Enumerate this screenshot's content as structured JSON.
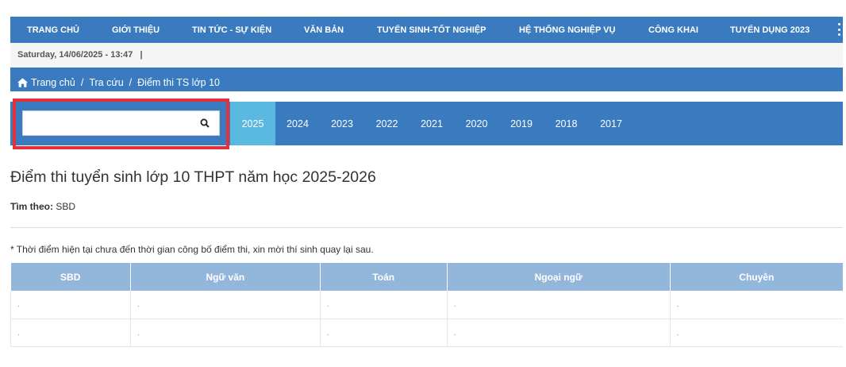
{
  "nav": {
    "items": [
      "TRANG CHỦ",
      "GIỚI THIỆU",
      "TIN TỨC - SỰ KIỆN",
      "VĂN BẢN",
      "TUYỂN SINH-TỐT NGHIỆP",
      "HỆ THỐNG NGHIỆP VỤ",
      "CÔNG KHAI",
      "TUYỂN DỤNG 2023"
    ],
    "more_icon": "vertical-ellipsis-icon"
  },
  "datebar": {
    "datetime": "Saturday, 14/06/2025 - 13:47",
    "separator": "|"
  },
  "breadcrumb": {
    "home": "Trang chủ",
    "lookup": "Tra cứu",
    "current": "Điểm thi TS lớp 10",
    "separator": "/"
  },
  "search": {
    "value": "",
    "placeholder": "",
    "icon": "search-icon"
  },
  "years": [
    "2025",
    "2024",
    "2023",
    "2022",
    "2021",
    "2020",
    "2019",
    "2018",
    "2017"
  ],
  "active_year": "2025",
  "page": {
    "title": "Điểm thi tuyển sinh lớp 10 THPT năm học 2025-2026",
    "find_by_label": "Tìm theo:",
    "find_by_value": "SBD",
    "notice": "* Thời điểm hiện tại chưa đến thời gian công bố điểm thi, xin mời thí sinh quay lại sau."
  },
  "table": {
    "headers": [
      "SBD",
      "Ngữ văn",
      "Toán",
      "Ngoại ngữ",
      "Chuyên"
    ],
    "rows": [
      [
        ".",
        ".",
        ".",
        ".",
        "."
      ],
      [
        ".",
        ".",
        ".",
        ".",
        "."
      ]
    ]
  },
  "colors": {
    "primary": "#3a7bbf",
    "active_tab": "#5bb8e0",
    "table_header": "#93b6db",
    "highlight": "#e3303a"
  }
}
